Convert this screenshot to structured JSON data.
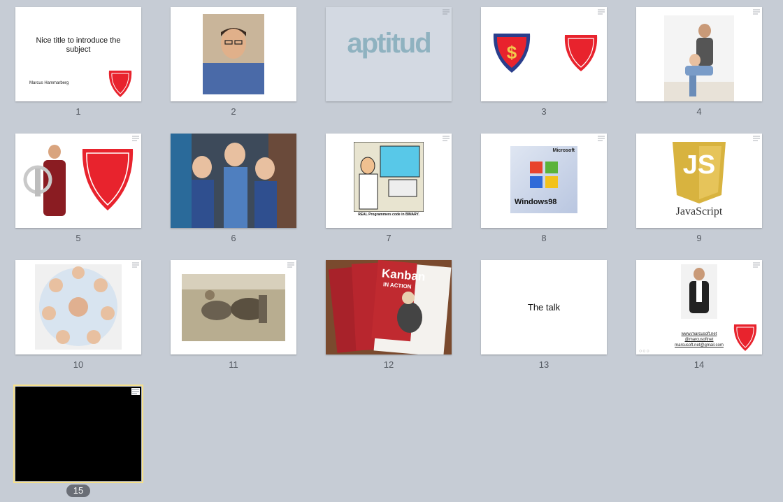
{
  "slides": [
    {
      "number": "1",
      "title": "Nice title to introduce the subject",
      "author": "Marcus Hammarberg",
      "logo_text": "THE SALVATION ARMY"
    },
    {
      "number": "2"
    },
    {
      "number": "",
      "skipped_text": "aptitud"
    },
    {
      "number": "3",
      "logo_text": "THE SALVATION ARMY"
    },
    {
      "number": "4"
    },
    {
      "number": "5",
      "logo_text": "THE SALVATION ARMY"
    },
    {
      "number": "6"
    },
    {
      "number": "7",
      "caption": "REAL Programmers code in BINARY."
    },
    {
      "number": "8",
      "brand": "Microsoft",
      "os_name": "Windows98"
    },
    {
      "number": "9",
      "logo_text": "JS",
      "label": "JavaScript"
    },
    {
      "number": "10"
    },
    {
      "number": "11"
    },
    {
      "number": "12",
      "book_title": "Kanban",
      "book_subtitle": "IN ACTION"
    },
    {
      "number": "13",
      "text": "The talk"
    },
    {
      "number": "14",
      "links": [
        "www.marcusoft.net",
        "@marcusoftnet",
        "marcusoft.net@gmail.com"
      ],
      "logo_text": "THE SALVATION ARMY"
    },
    {
      "number": "15",
      "selected": true
    }
  ],
  "colors": {
    "background": "#c6ccd5",
    "selection": "#f6e08a",
    "salvation_red": "#e8232d",
    "js_gold": "#d8b33f"
  }
}
